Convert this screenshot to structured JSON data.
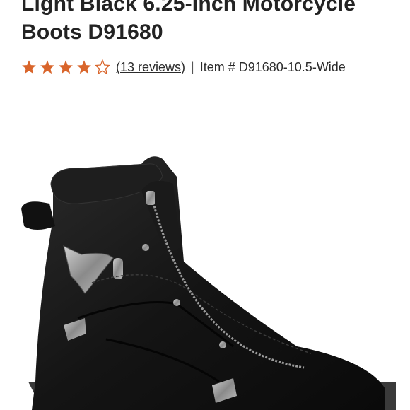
{
  "product": {
    "title_line1": "Light Black 6.25-Inch Motorcycle",
    "title_line2": "Boots D91680",
    "rating": 4,
    "rating_max": 5,
    "reviews_label": "(13 reviews)",
    "separator": "|",
    "item_number": "Item # D91680-10.5-Wide"
  },
  "colors": {
    "star_filled": "#d9652b",
    "star_empty_outline": "#d9652b",
    "title": "#232323"
  },
  "icons": {
    "filled_star": "star-filled-icon",
    "empty_star": "star-outline-icon"
  }
}
